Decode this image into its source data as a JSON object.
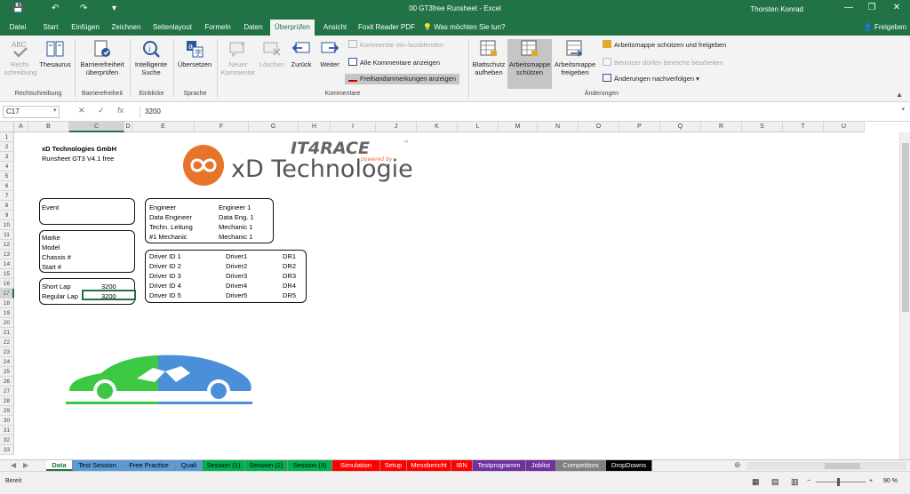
{
  "window": {
    "title": "00 GT3free Runsheet - Excel",
    "user": "Thorsten Konrad",
    "minimize_glyph": "—",
    "restore_glyph": "❐",
    "close_glyph": "✕",
    "quick_access": [
      "💾",
      "↶",
      "↷",
      "▾"
    ]
  },
  "ribbon_tabs": [
    "Datei",
    "Start",
    "Einfügen",
    "Zeichnen",
    "Seitenlayout",
    "Formeln",
    "Daten",
    "Überprüfen",
    "Ansicht",
    "Foxit Reader PDF"
  ],
  "active_tab": "Überprüfen",
  "tell_me": "Was möchten Sie tun?",
  "share": "Freigeben",
  "ribbon": {
    "spelling": "Recht-\nschreibung",
    "thesaurus": "Thesaurus",
    "accessibility": "Barrierefreiheit\nüberprüfen",
    "smart_lookup": "Intelligente\nSuche",
    "translate": "Übersetzen",
    "new_comment": "Neuer\nKommentar",
    "delete": "Löschen",
    "back": "Zurück",
    "forward": "Weiter",
    "show_hide_comment": "Kommentar ein-/ausblenden",
    "show_all_comments": "Alle Kommentare anzeigen",
    "show_ink": "Freihandanmerkungen anzeigen",
    "unprotect_sheet": "Blattschutz\naufheben",
    "protect_workbook": "Arbeitsmappe\nschützen",
    "share_workbook": "Arbeitsmappe\nfreigeben",
    "protect_share": "Arbeitsmappe schützen und freigeben",
    "allow_ranges": "Benutzer dürfen Bereiche bearbeiten",
    "track_changes": "Änderungen nachverfolgen ▾",
    "groups": {
      "proofing": "Rechtschreibung",
      "accessibility": "Barrierefreiheit",
      "insights": "Einblicke",
      "language": "Sprache",
      "comments": "Kommentare",
      "changes": "Änderungen"
    }
  },
  "formula_bar": {
    "cell_ref": "C17",
    "value": "3200",
    "fx": "fx",
    "cancel": "✕",
    "confirm": "✓"
  },
  "columns": [
    "A",
    "B",
    "C",
    "D",
    "E",
    "F",
    "G",
    "H",
    "I",
    "J",
    "K",
    "L",
    "M",
    "N",
    "O",
    "P",
    "Q",
    "R",
    "S",
    "T",
    "U"
  ],
  "selected_column": "C",
  "rows": [
    "1",
    "2",
    "3",
    "4",
    "5",
    "6",
    "7",
    "8",
    "9",
    "10",
    "11",
    "12",
    "13",
    "14",
    "15",
    "16",
    "17",
    "18",
    "19",
    "20",
    "21",
    "22",
    "23",
    "24",
    "25",
    "26",
    "27",
    "28",
    "29",
    "30",
    "31",
    "32",
    "33"
  ],
  "selected_row": "17",
  "sheet": {
    "company": "xD Technologies GmbH",
    "runsheet": "Runsheet GT3 V4.1 free",
    "event_label": "Event",
    "car_labels": [
      "Marke",
      "Model",
      "Chassis #",
      "Start #"
    ],
    "short_lap_label": "Short Lap",
    "short_lap_value": "3200",
    "regular_lap_label": "Regular Lap",
    "regular_lap_value": "3200",
    "staff": [
      {
        "role": "Engineer",
        "name": "Engineer 1"
      },
      {
        "role": "Data Engineer",
        "name": "Data Eng. 1"
      },
      {
        "role": "Techn. Leitung",
        "name": "Mechanic 1"
      },
      {
        "role": "#1 Mechanic",
        "name": "Mechanic 1"
      }
    ],
    "drivers": [
      {
        "id": "Driver ID 1",
        "name": "Driver1",
        "code": "DR1"
      },
      {
        "id": "Driver ID 2",
        "name": "Driver2",
        "code": "DR2"
      },
      {
        "id": "Driver ID 3",
        "name": "Driver3",
        "code": "DR3"
      },
      {
        "id": "Driver ID 4",
        "name": "Driver4",
        "code": "DR4"
      },
      {
        "id": "Driver ID 5",
        "name": "Driver5",
        "code": "DR5"
      }
    ],
    "logo_brand": "IT4RACE",
    "logo_tagline": "powered by",
    "logo_company": "xD Technologies",
    "logo_tm": "™"
  },
  "sheet_tabs": [
    {
      "label": "Data",
      "color": "#ffffff"
    },
    {
      "label": "Test Session",
      "color": "#5b9bd5"
    },
    {
      "label": "Free Practise",
      "color": "#5b9bd5"
    },
    {
      "label": "Quali",
      "color": "#5b9bd5"
    },
    {
      "label": "Session (1)",
      "color": "#00b050"
    },
    {
      "label": "Session (2)",
      "color": "#00b050"
    },
    {
      "label": "Session (3)",
      "color": "#00b050"
    },
    {
      "label": "Simulation",
      "color": "#ff0000"
    },
    {
      "label": "Setup",
      "color": "#ff0000"
    },
    {
      "label": "Messbericht",
      "color": "#ff0000"
    },
    {
      "label": "IBN",
      "color": "#ff0000"
    },
    {
      "label": "Testprogramm",
      "color": "#7030a0"
    },
    {
      "label": "Joblist",
      "color": "#7030a0"
    },
    {
      "label": "Competitors",
      "color": "#808080"
    },
    {
      "label": "DropDowns",
      "color": "#000000"
    }
  ],
  "status": {
    "ready": "Bereit",
    "zoom": "90 %",
    "minus": "−",
    "plus": "+"
  },
  "colors": {
    "excel_green": "#217346",
    "logo_orange": "#e8742a",
    "car_blue": "#4a8fd8",
    "car_green": "#3cc843"
  }
}
